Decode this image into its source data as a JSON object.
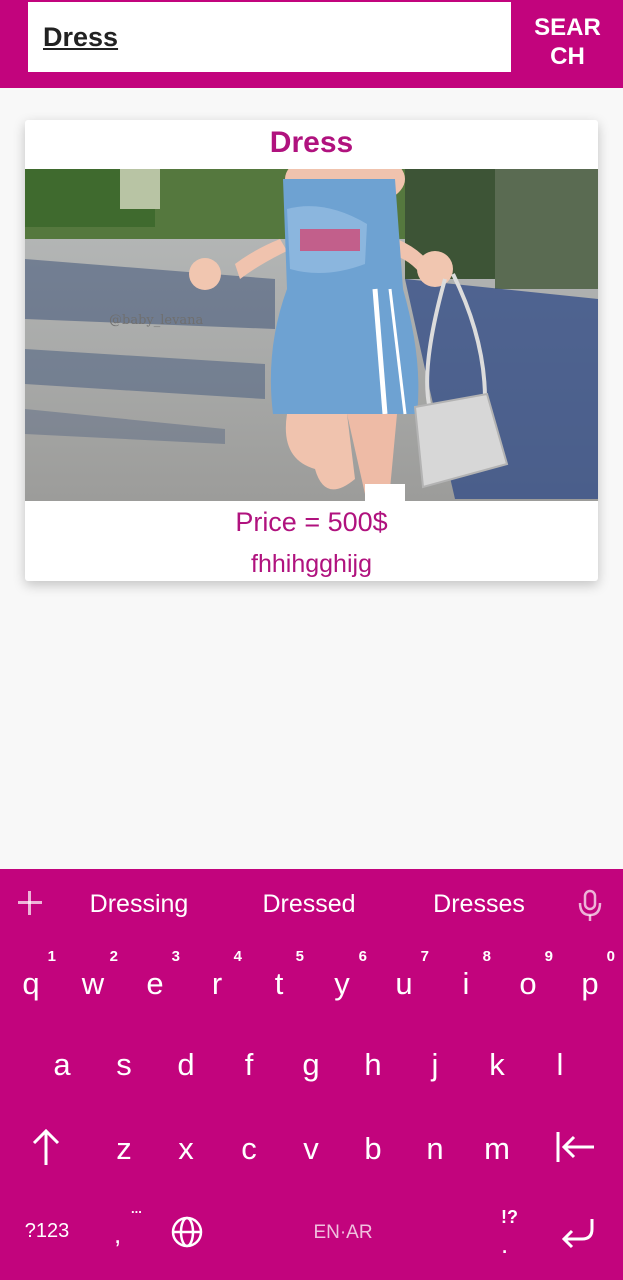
{
  "search": {
    "value": "Dress",
    "button_label": "SEAR\nCH"
  },
  "product": {
    "title": "Dress",
    "price_text": "Price = 500$",
    "description": "fhhihgghijg",
    "image_watermark": "@baby_levana"
  },
  "keyboard": {
    "suggestions": [
      "Dressing",
      "Dressed",
      "Dresses"
    ],
    "row1": [
      {
        "key": "q",
        "hint": "1"
      },
      {
        "key": "w",
        "hint": "2"
      },
      {
        "key": "e",
        "hint": "3"
      },
      {
        "key": "r",
        "hint": "4"
      },
      {
        "key": "t",
        "hint": "5"
      },
      {
        "key": "y",
        "hint": "6"
      },
      {
        "key": "u",
        "hint": "7"
      },
      {
        "key": "i",
        "hint": "8"
      },
      {
        "key": "o",
        "hint": "9"
      },
      {
        "key": "p",
        "hint": "0"
      }
    ],
    "row2": [
      "a",
      "s",
      "d",
      "f",
      "g",
      "h",
      "j",
      "k",
      "l"
    ],
    "row3": [
      "z",
      "x",
      "c",
      "v",
      "b",
      "n",
      "m"
    ],
    "symbols_label": "?123",
    "comma_label": ",",
    "comma_hint": "...",
    "space_label": "EN·AR",
    "period_label": ".",
    "period_hint": "!?",
    "icons": [
      "plus-icon",
      "mic-icon",
      "shift-icon",
      "backspace-icon",
      "globe-icon",
      "enter-icon"
    ]
  },
  "colors": {
    "accent": "#c2047d",
    "product_text": "#b0127e"
  }
}
